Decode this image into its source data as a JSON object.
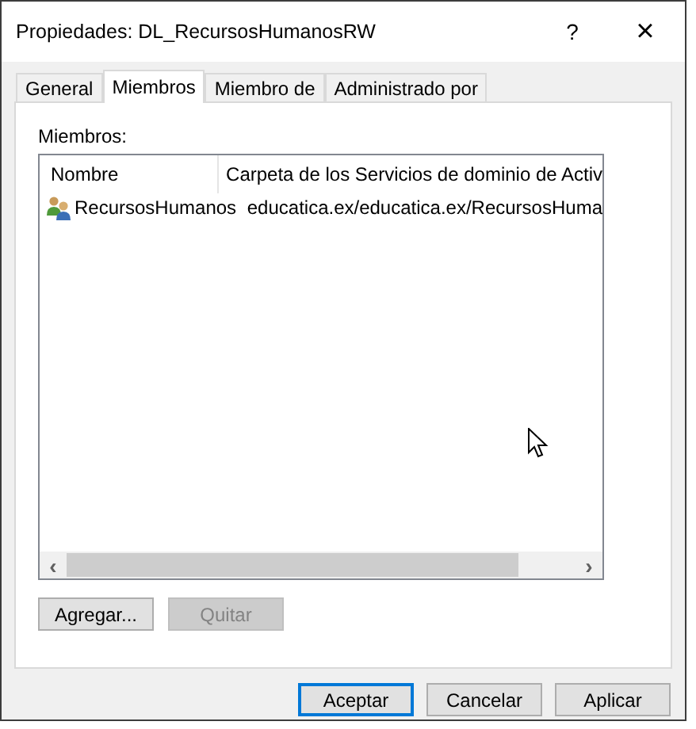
{
  "window": {
    "title": "Propiedades: DL_RecursosHumanosRW",
    "help": "?",
    "close": "×"
  },
  "tabs": [
    {
      "label": "General",
      "selected": false
    },
    {
      "label": "Miembros",
      "selected": true
    },
    {
      "label": "Miembro de",
      "selected": false
    },
    {
      "label": "Administrado por",
      "selected": false
    }
  ],
  "members_label": "Miembros:",
  "table": {
    "columns": [
      "Nombre",
      "Carpeta de los Servicios de dominio de Activ"
    ],
    "rows": [
      {
        "cells": [
          "RecursosHumanos",
          "educatica.ex/educatica.ex/RecursosHuma"
        ]
      }
    ],
    "scroll": {
      "left": "‹",
      "right": "›"
    }
  },
  "member_buttons": [
    {
      "label": "Agregar...",
      "disabled": false
    },
    {
      "label": "Quitar",
      "disabled": true
    }
  ],
  "footer_buttons": [
    {
      "label": "Aceptar",
      "default": true
    },
    {
      "label": "Cancelar",
      "default": false
    },
    {
      "label": "Aplicar",
      "default": false
    }
  ]
}
